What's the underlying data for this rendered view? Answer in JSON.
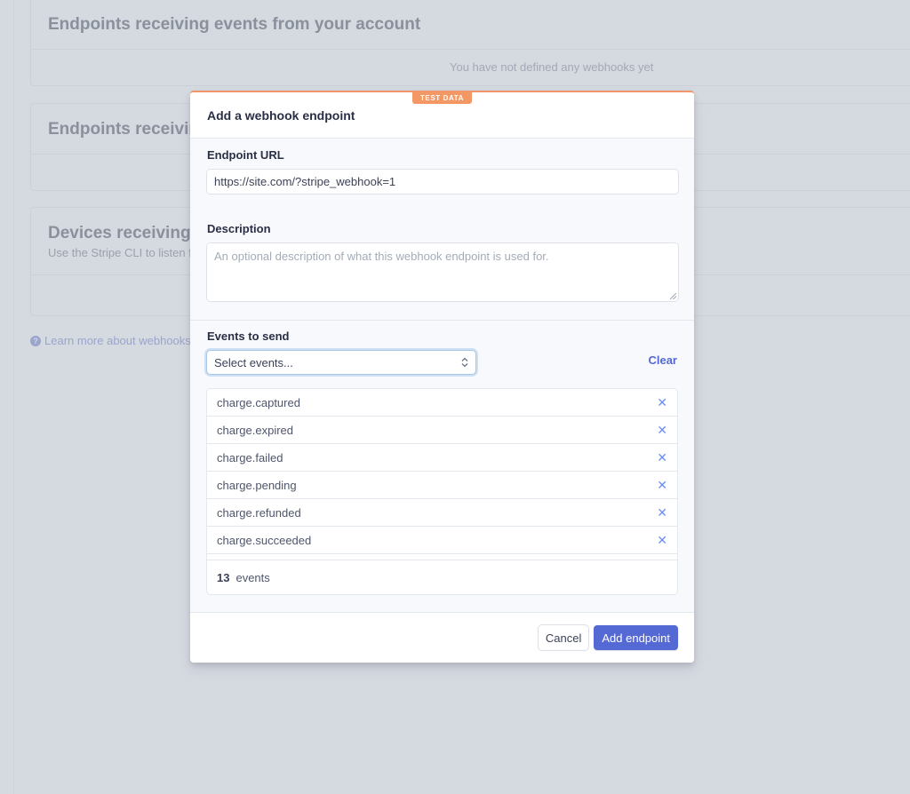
{
  "background": {
    "cards": [
      {
        "title": "Endpoints receiving events from your account",
        "empty_text": "You have not defined any webhooks yet"
      },
      {
        "title": "Endpoints receiving events from Connect applications"
      },
      {
        "title": "Devices receiving events with the Stripe CLI",
        "subtitle": "Use the Stripe CLI to listen for events locally."
      }
    ],
    "learn_more": "Learn more about webhooks"
  },
  "modal": {
    "badge": "TEST DATA",
    "title": "Add a webhook endpoint",
    "endpoint_url": {
      "label": "Endpoint URL",
      "value": "https://site.com/?stripe_webhook=1"
    },
    "description": {
      "label": "Description",
      "placeholder": "An optional description of what this webhook endpoint is used for."
    },
    "events": {
      "label": "Events to send",
      "select_placeholder": "Select events...",
      "clear_label": "Clear",
      "items": [
        "charge.captured",
        "charge.expired",
        "charge.failed",
        "charge.pending",
        "charge.refunded",
        "charge.succeeded"
      ],
      "count": "13",
      "count_label": "events"
    },
    "buttons": {
      "cancel": "Cancel",
      "submit": "Add endpoint"
    }
  },
  "colors": {
    "accent": "#5469d4",
    "test_badge": "#f39865",
    "remove_icon": "#6c8ef0"
  }
}
